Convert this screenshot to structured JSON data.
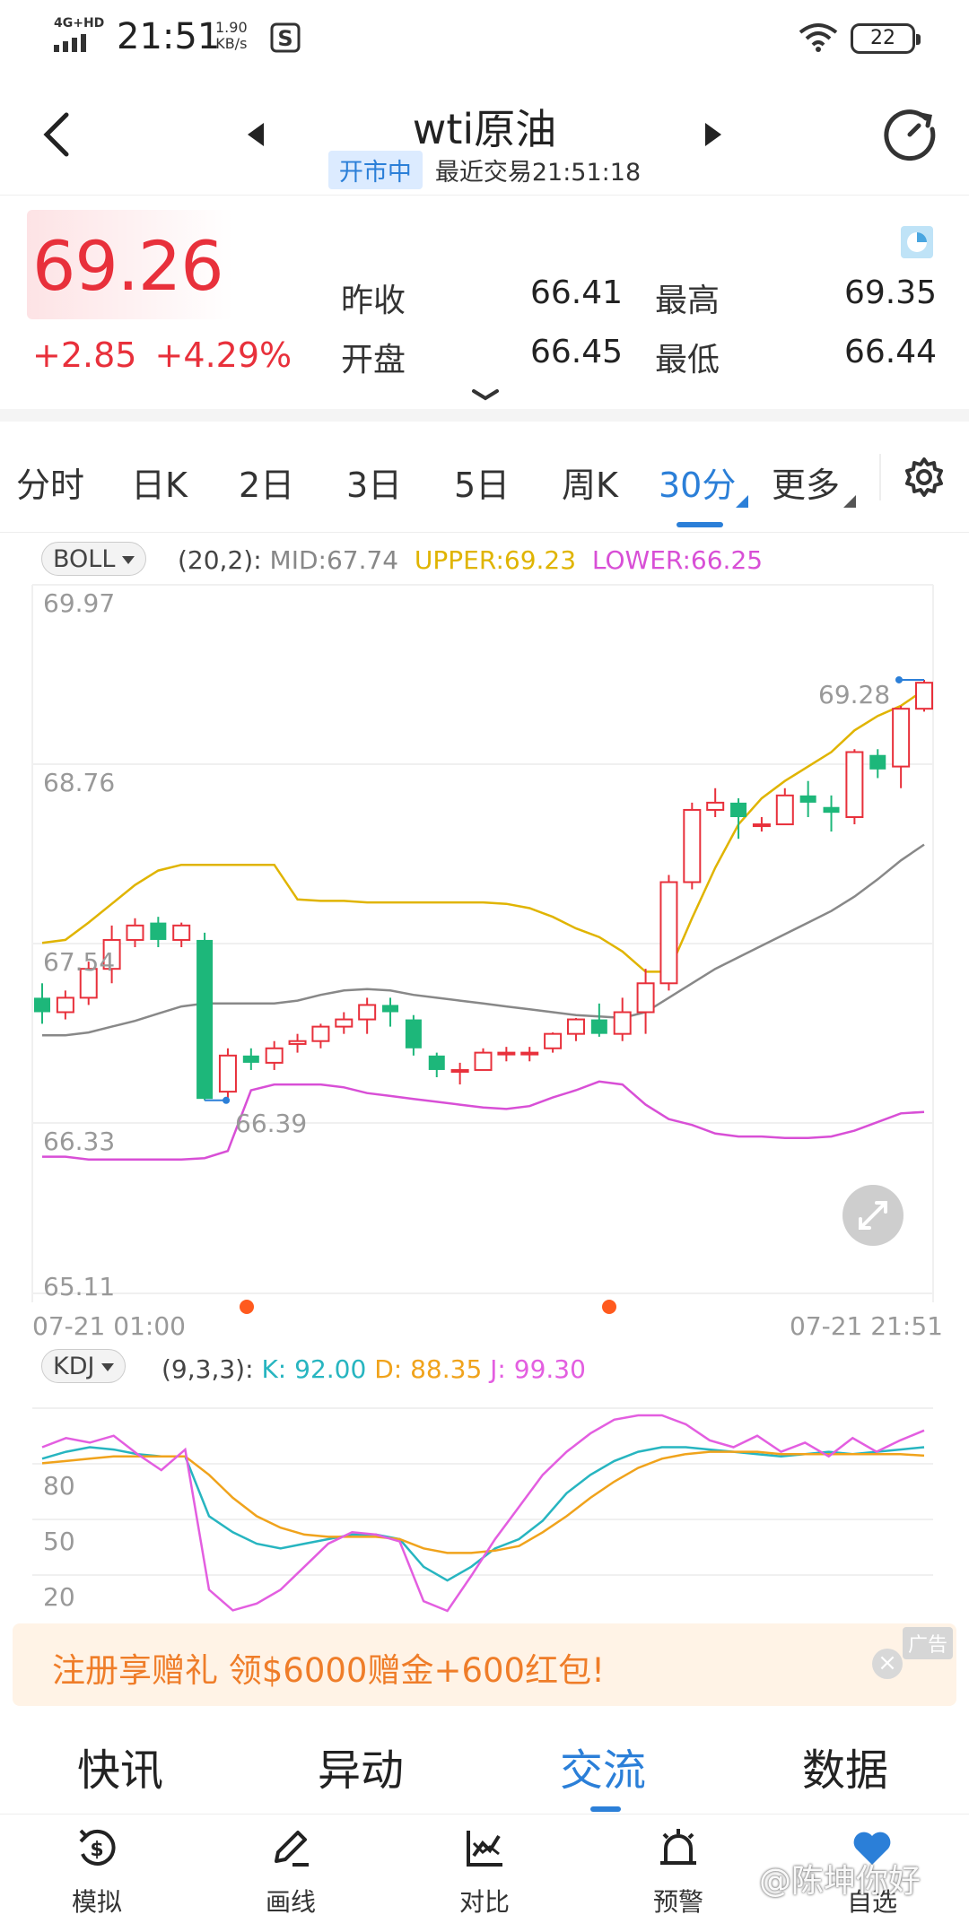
{
  "status_bar": {
    "network": "4G+HD",
    "time": "21:51",
    "speed_value": "1.90",
    "speed_unit": "KB/s",
    "battery": "22"
  },
  "header": {
    "title": "wti原油",
    "market_status": "开市中",
    "last_trade": "最近交易21:51:18"
  },
  "quote": {
    "price": "69.26",
    "change": "+2.85",
    "change_pct": "+4.29%",
    "stats": [
      {
        "label": "昨收",
        "value": "66.41"
      },
      {
        "label": "最高",
        "value": "69.35"
      },
      {
        "label": "开盘",
        "value": "66.45"
      },
      {
        "label": "最低",
        "value": "66.44"
      }
    ]
  },
  "period_tabs": [
    "分时",
    "日K",
    "2日",
    "3日",
    "5日",
    "周K",
    "30分",
    "更多"
  ],
  "active_period": "30分",
  "boll": {
    "name": "BOLL",
    "params": "(20,2):",
    "mid": "MID:67.74",
    "upper": "UPPER:69.23",
    "lower": "LOWER:66.25"
  },
  "kdj": {
    "name": "KDJ",
    "params": "(9,3,3):",
    "k": "K: 92.00",
    "d": "D: 88.35",
    "j": "J: 99.30"
  },
  "price_chart": {
    "y_labels": [
      "69.97",
      "68.76",
      "67.54",
      "66.33",
      "65.11"
    ],
    "x_start": "07-21 01:00",
    "x_end": "07-21 21:51",
    "last_marker": "69.28",
    "low_marker": "66.39"
  },
  "kdj_chart": {
    "y_labels": [
      "80",
      "50",
      "20"
    ]
  },
  "chart_data": [
    {
      "type": "candlestick",
      "title": "wti原油 30分",
      "ylim": [
        65.11,
        69.97
      ],
      "candles": [
        [
          67.1,
          67.0,
          67.2,
          66.92
        ],
        [
          67.0,
          67.1,
          67.15,
          66.95
        ],
        [
          67.1,
          67.3,
          67.35,
          67.05
        ],
        [
          67.3,
          67.5,
          67.6,
          67.2
        ],
        [
          67.5,
          67.6,
          67.65,
          67.45
        ],
        [
          67.62,
          67.5,
          67.66,
          67.45
        ],
        [
          67.5,
          67.6,
          67.62,
          67.45
        ],
        [
          67.5,
          66.4,
          67.55,
          66.39
        ],
        [
          66.45,
          66.7,
          66.75,
          66.4
        ],
        [
          66.7,
          66.65,
          66.75,
          66.6
        ],
        [
          66.65,
          66.75,
          66.8,
          66.6
        ],
        [
          66.78,
          66.8,
          66.85,
          66.72
        ],
        [
          66.8,
          66.9,
          66.92,
          66.75
        ],
        [
          66.9,
          66.95,
          67.0,
          66.85
        ],
        [
          66.95,
          67.05,
          67.1,
          66.85
        ],
        [
          67.05,
          67.0,
          67.1,
          66.9
        ],
        [
          66.95,
          66.75,
          66.98,
          66.7
        ],
        [
          66.7,
          66.6,
          66.72,
          66.55
        ],
        [
          66.6,
          66.6,
          66.65,
          66.5
        ],
        [
          66.6,
          66.72,
          66.75,
          66.6
        ],
        [
          66.72,
          66.72,
          66.76,
          66.66
        ],
        [
          66.72,
          66.72,
          66.76,
          66.66
        ],
        [
          66.75,
          66.85,
          66.86,
          66.72
        ],
        [
          66.85,
          66.95,
          66.96,
          66.8
        ],
        [
          66.95,
          66.85,
          67.06,
          66.83
        ],
        [
          66.85,
          67.0,
          67.1,
          66.8
        ],
        [
          67.0,
          67.2,
          67.3,
          66.85
        ],
        [
          67.2,
          67.9,
          67.95,
          67.15
        ],
        [
          67.9,
          68.4,
          68.45,
          67.85
        ],
        [
          68.4,
          68.45,
          68.55,
          68.35
        ],
        [
          68.45,
          68.35,
          68.48,
          68.2
        ],
        [
          68.3,
          68.3,
          68.35,
          68.25
        ],
        [
          68.3,
          68.5,
          68.55,
          68.3
        ],
        [
          68.5,
          68.45,
          68.6,
          68.35
        ],
        [
          68.42,
          68.38,
          68.5,
          68.25
        ],
        [
          68.35,
          68.8,
          68.82,
          68.3
        ],
        [
          68.78,
          68.68,
          68.82,
          68.62
        ],
        [
          68.7,
          69.1,
          69.12,
          68.55
        ],
        [
          69.1,
          69.28,
          69.3,
          69.08
        ]
      ],
      "boll_upper": [
        67.48,
        67.5,
        67.62,
        67.75,
        67.88,
        67.98,
        68.02,
        68.02,
        68.02,
        68.02,
        68.02,
        67.78,
        67.77,
        67.77,
        67.76,
        67.76,
        67.76,
        67.76,
        67.76,
        67.76,
        67.75,
        67.72,
        67.66,
        67.58,
        67.52,
        67.42,
        67.28,
        67.28,
        67.65,
        68.0,
        68.3,
        68.48,
        68.6,
        68.7,
        68.8,
        68.95,
        69.05,
        69.12,
        69.23
      ],
      "boll_mid": [
        66.84,
        66.84,
        66.86,
        66.9,
        66.94,
        66.99,
        67.04,
        67.06,
        67.06,
        67.06,
        67.06,
        67.08,
        67.12,
        67.15,
        67.16,
        67.15,
        67.12,
        67.1,
        67.08,
        67.06,
        67.04,
        67.02,
        67.0,
        66.98,
        66.97,
        66.96,
        67.0,
        67.1,
        67.2,
        67.3,
        67.38,
        67.46,
        67.54,
        67.62,
        67.7,
        67.8,
        67.92,
        68.05,
        68.16
      ],
      "boll_lower": [
        66.0,
        66.0,
        65.98,
        65.98,
        65.98,
        65.98,
        65.98,
        65.99,
        66.04,
        66.46,
        66.5,
        66.5,
        66.5,
        66.48,
        66.44,
        66.42,
        66.4,
        66.38,
        66.36,
        66.34,
        66.33,
        66.35,
        66.41,
        66.46,
        66.52,
        66.5,
        66.36,
        66.26,
        66.22,
        66.16,
        66.14,
        66.14,
        66.13,
        66.13,
        66.14,
        66.18,
        66.24,
        66.3,
        66.31
      ]
    },
    {
      "type": "line",
      "title": "KDJ (9,3,3)",
      "ylim": [
        20,
        100
      ],
      "series": [
        {
          "name": "K",
          "values": [
            87,
            90,
            92,
            91,
            89,
            88,
            88,
            62,
            55,
            50,
            48,
            50,
            52,
            54,
            54,
            52,
            40,
            34,
            40,
            48,
            52,
            60,
            72,
            80,
            86,
            90,
            92,
            92,
            91,
            90,
            89,
            88,
            89,
            90,
            89,
            90,
            91,
            92
          ]
        },
        {
          "name": "D",
          "values": [
            85,
            86,
            87,
            88,
            88,
            88,
            88,
            80,
            70,
            62,
            57,
            54,
            53,
            53,
            53,
            52,
            48,
            46,
            46,
            47,
            49,
            55,
            62,
            70,
            77,
            83,
            87,
            89,
            90,
            90,
            90,
            89,
            89,
            89,
            89,
            89,
            89,
            88.35
          ]
        },
        {
          "name": "J",
          "values": [
            92,
            96,
            94,
            97,
            89,
            82,
            91,
            30,
            21,
            24,
            30,
            40,
            50,
            55,
            54,
            51,
            25,
            17,
            36,
            52,
            66,
            80,
            90,
            98,
            104,
            110,
            106,
            102,
            95,
            92,
            97,
            90,
            94,
            88,
            96,
            90,
            95,
            99.3
          ]
        }
      ]
    }
  ],
  "ad": {
    "text": "注册享赠礼 领$6000赠金+600红包!",
    "tag": "广告",
    "close": "×"
  },
  "section_tabs": [
    "快讯",
    "异动",
    "交流",
    "数据"
  ],
  "active_section": "交流",
  "bottom_nav": [
    "模拟",
    "画线",
    "对比",
    "预警",
    "自选"
  ],
  "watermark": "@陈坤你好",
  "colors": {
    "up": "#e8303b",
    "down": "#1db77a",
    "accent": "#2b7fd8",
    "boll_mid": "#888888",
    "boll_upper": "#e0b400",
    "boll_lower": "#d84fd6",
    "kdj_k": "#27b5c0",
    "kdj_d": "#f0a31c",
    "kdj_j": "#e35ee0"
  }
}
